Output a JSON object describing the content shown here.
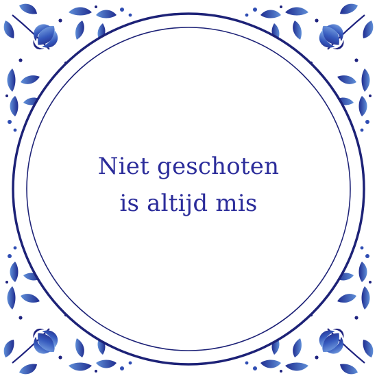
{
  "tile": {
    "quote_line_1": "Niet geschoten",
    "quote_line_2": "is altijd mis"
  },
  "colors": {
    "ink_dark": "#1f237f",
    "ink_mid": "#2f4db3",
    "ink_light": "#6f9de2",
    "background": "#ffffff",
    "ring": "#1d2277"
  },
  "ornaments": {
    "style": "delft-blue-floral-corners",
    "corner_icons": [
      "tulip-icon",
      "leaf-spray-icon",
      "dot-icon"
    ]
  }
}
